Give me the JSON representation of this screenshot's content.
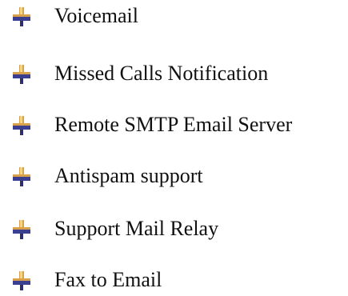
{
  "features": [
    {
      "label": "Voicemail",
      "icon": "pushpin-bullet-icon"
    },
    {
      "label": "Missed Calls Notification",
      "icon": "pushpin-bullet-icon"
    },
    {
      "label": "Remote SMTP Email Server",
      "icon": "pushpin-bullet-icon"
    },
    {
      "label": "Antispam support",
      "icon": "pushpin-bullet-icon"
    },
    {
      "label": "Support Mail Relay",
      "icon": "pushpin-bullet-icon"
    },
    {
      "label": "Fax to Email",
      "icon": "pushpin-bullet-icon"
    }
  ],
  "colors": {
    "text": "#111111",
    "bullet_top": "#d9a24a",
    "bullet_top_light": "#f3d58c",
    "bullet_bar": "#3b3f8f",
    "bullet_stem": "#2b2f6e"
  }
}
